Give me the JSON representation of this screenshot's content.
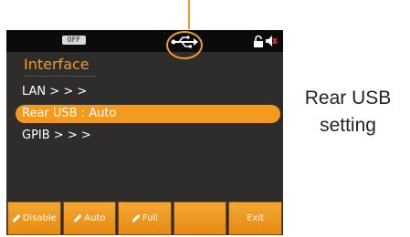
{
  "statusbar": {
    "output_state": "OFF",
    "icons": [
      "usb-icon",
      "lock-icon",
      "speaker-muted-icon"
    ]
  },
  "menu": {
    "title": "Interface",
    "items": [
      {
        "label": "LAN  > > >",
        "selected": false
      },
      {
        "label": "Rear  USB  :  Auto",
        "selected": true
      },
      {
        "label": "GPIB  > > >",
        "selected": false
      }
    ]
  },
  "softkeys": [
    {
      "label": "Disable",
      "icon": "pen-icon"
    },
    {
      "label": "Auto",
      "icon": "pen-icon"
    },
    {
      "label": "Full",
      "icon": "pen-icon"
    },
    {
      "label": "",
      "icon": ""
    },
    {
      "label": "Exit",
      "icon": ""
    }
  ],
  "caption": {
    "line1": "Rear USB",
    "line2": "setting"
  },
  "colors": {
    "accent": "#f39a1e",
    "screen_bg": "#2e2d2c",
    "statusbar_bg": "#0b0b0b",
    "title_underline": "#1e4fd8"
  }
}
